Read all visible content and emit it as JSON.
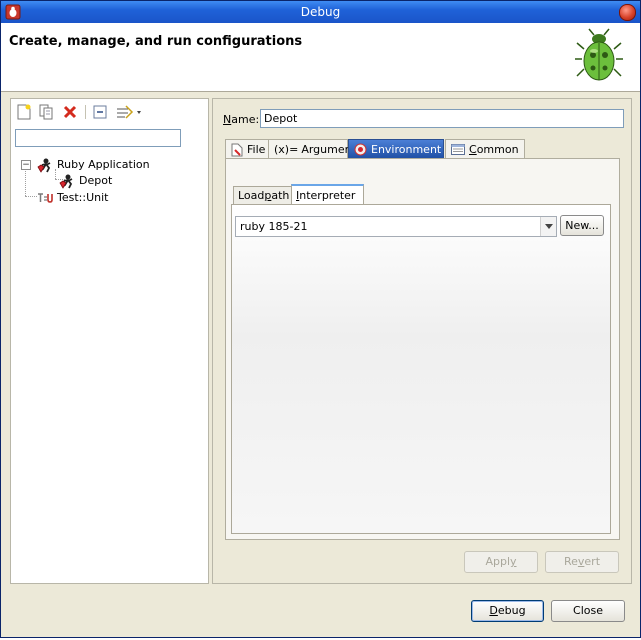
{
  "window": {
    "title": "Debug"
  },
  "header": {
    "title": "Create, manage, and run configurations"
  },
  "icons": {
    "app": "debug-app-icon",
    "close": "close-icon",
    "header": "bug-icon",
    "new_config": "new-config-icon",
    "duplicate": "duplicate-icon",
    "delete": "delete-icon",
    "collapse_all": "collapse-all-icon",
    "filter": "filter-icon",
    "ruby": "ruby-gem-icon",
    "test": "test-unit-icon",
    "file_tab": "file-icon",
    "arguments_tab": "arguments-icon",
    "environment_tab": "environment-icon",
    "common_tab": "common-icon"
  },
  "filter": {
    "value": ""
  },
  "tree": {
    "items": [
      {
        "label": "Ruby Application",
        "expanded": true
      },
      {
        "label": "Depot"
      },
      {
        "label": "Test::Unit"
      }
    ]
  },
  "config": {
    "name_label": "Name:",
    "name_mnemonic": "N",
    "name_rest": "ame:",
    "name_value": "Depot",
    "tabs": [
      {
        "label": "File"
      },
      {
        "label": "Arguments",
        "prefix": "(x)="
      },
      {
        "label": "Environment",
        "active": true
      },
      {
        "label": "Common",
        "mnemonic": "C",
        "rest": "ommon"
      }
    ],
    "subtabs": [
      {
        "label": "Loadpath",
        "pre": "Load",
        "mnemonic": "p",
        "rest": "ath"
      },
      {
        "label": "Interpreter",
        "mnemonic": "I",
        "rest": "nterpreter",
        "active": true
      }
    ],
    "interpreter": {
      "selected": "ruby 185-21"
    },
    "new_button": "New...",
    "new_button_pre": "New",
    "new_button_rest": "..."
  },
  "buttons": {
    "apply": "Apply",
    "apply_pre": "Appl",
    "apply_m": "y",
    "apply_rest": "",
    "revert": "Revert",
    "revert_pre": "Re",
    "revert_m": "v",
    "revert_rest": "ert",
    "debug": "Debug",
    "debug_m": "D",
    "debug_rest": "ebug",
    "close": "Close"
  },
  "colors": {
    "titlebar": "#1f62d8",
    "active_tab": "#2a5bb5",
    "delete_red": "#d42b1e",
    "bug_green": "#5aa830"
  }
}
